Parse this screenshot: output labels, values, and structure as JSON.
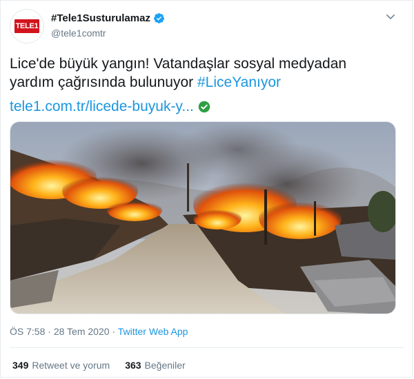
{
  "tweet": {
    "avatar_logo_text": "TELE1",
    "display_name": "#Tele1Susturulamaz",
    "handle": "@tele1comtr",
    "text_line1": "Lice'de büyük yangın! Vatandaşlar sosyal medyadan",
    "text_line2_start": "yardım çağrısında bulunuyor ",
    "hashtag": "#LiceYanıyor",
    "link": "tele1.com.tr/licede-buyuk-y...",
    "time": "ÖS 7:58",
    "separator": " · ",
    "date": "28 Tem 2020",
    "app": "Twitter Web App",
    "retweets_count": "349",
    "retweets_label": "Retweet ve yorum",
    "likes_count": "363",
    "likes_label": "Beğeniler"
  },
  "icons": [
    "verified-icon",
    "chevron-down-icon",
    "link-check-icon"
  ],
  "colors": {
    "link": "#1b95e0",
    "text": "#14171a",
    "muted": "#657786",
    "logo_red": "#d3121c"
  }
}
